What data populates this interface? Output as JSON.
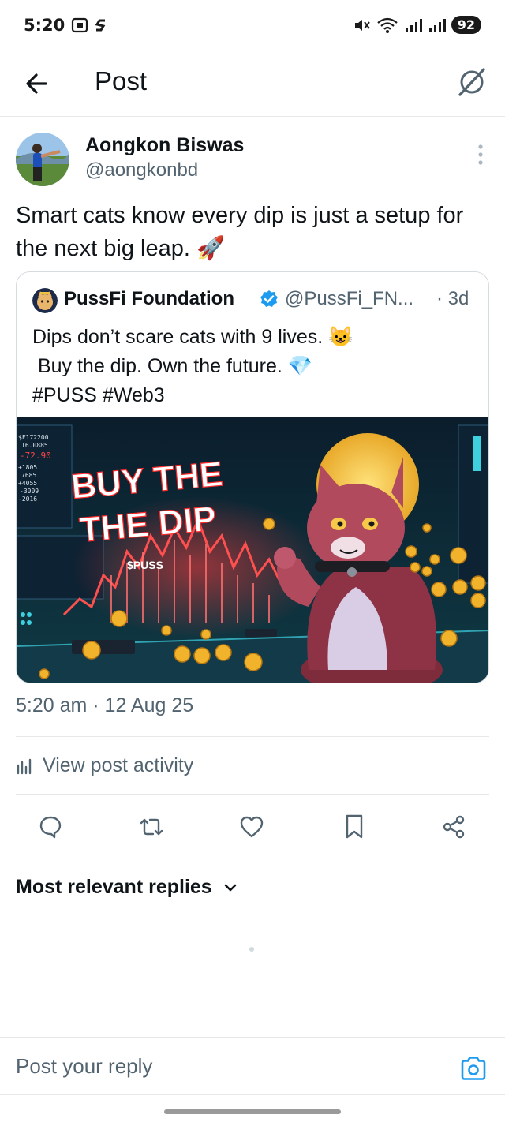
{
  "status_bar": {
    "time": "5:20",
    "battery": "92",
    "icons": [
      "screenshot-icon",
      "app-s-icon",
      "mute-icon",
      "wifi-icon",
      "signal-icon",
      "signal-icon"
    ]
  },
  "header": {
    "title": "Post",
    "back_icon": "arrow-left-icon",
    "grok_icon": "grok-icon"
  },
  "post": {
    "author_name": "Aongkon Biswas",
    "author_handle": "@aongkonbd",
    "text": "Smart cats know every dip is just a setup for the next big leap. 🚀",
    "timestamp": "5:20 am · 12 Aug 25",
    "activity_label": "View post activity"
  },
  "quote": {
    "name": "PussFi Foundation",
    "handle": "@PussFi_FN...",
    "time": "· 3d",
    "lines": [
      "Dips don’t scare cats with 9 lives. 😺",
      " Buy the dip. Own the future. 💎",
      "#PUSS #Web3"
    ],
    "image": {
      "headline_1": "BUY THE",
      "headline_2": "THE DIP",
      "token": "$PUSS",
      "ticker_lines": [
        "$F172200",
        "16.0885",
        "-72.90",
        "+1805",
        "7685",
        "+4055",
        "-3009",
        "-2016"
      ]
    }
  },
  "actions": [
    "reply",
    "repost",
    "like",
    "bookmark",
    "share"
  ],
  "replies": {
    "sort_label": "Most relevant replies"
  },
  "reply_bar": {
    "placeholder": "Post your reply"
  },
  "colors": {
    "text": "#0f1419",
    "secondary": "#536471",
    "accent": "#1d9bf0",
    "divider": "#e6e8ea"
  }
}
